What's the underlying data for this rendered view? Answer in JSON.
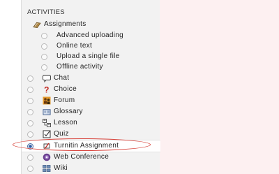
{
  "section": {
    "heading": "ACTIVITIES"
  },
  "assignments": {
    "label": "Assignments",
    "subtypes": [
      {
        "label": "Advanced uploading"
      },
      {
        "label": "Online text"
      },
      {
        "label": "Upload a single file"
      },
      {
        "label": "Offline activity"
      }
    ]
  },
  "activities": [
    {
      "label": "Chat",
      "icon": "chat-icon"
    },
    {
      "label": "Choice",
      "icon": "choice-icon"
    },
    {
      "label": "Forum",
      "icon": "forum-icon"
    },
    {
      "label": "Glossary",
      "icon": "glossary-icon"
    },
    {
      "label": "Lesson",
      "icon": "lesson-icon"
    },
    {
      "label": "Quiz",
      "icon": "quiz-icon"
    },
    {
      "label": "Turnitin Assignment",
      "icon": "turnitin-icon",
      "selected": true
    },
    {
      "label": "Web Conference",
      "icon": "web-conference-icon"
    },
    {
      "label": "Wiki",
      "icon": "wiki-icon"
    }
  ],
  "colors": {
    "highlight": "#d8443c",
    "panel": "#f2f2f2",
    "selected_radio": "#2d5aa0"
  }
}
